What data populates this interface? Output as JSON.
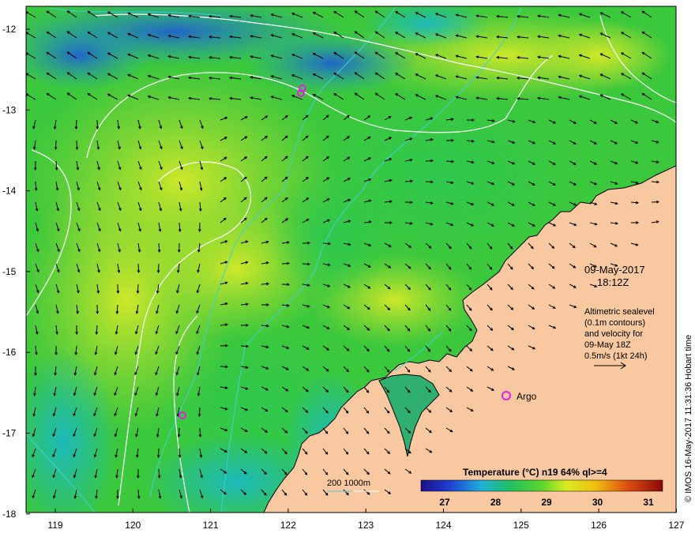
{
  "map": {
    "date": "09-May-2017",
    "time": "18:12Z",
    "altimetry_lines": [
      "Altimetric sealevel",
      "(0.1m contours)",
      "and velocity for",
      "09-May 18Z",
      "0.5m/s (1kt 24h)"
    ],
    "argo_label": "Argo",
    "depth_legend": "200  1000m",
    "colorbar_title": "Temperature (°C) n19 64% ql>=4",
    "colorbar_ticks": [
      "27",
      "28",
      "29",
      "30",
      "31"
    ],
    "lat_ticks": [
      "-12",
      "-13",
      "-14",
      "-15",
      "-16",
      "-17",
      "-18"
    ],
    "lon_ticks": [
      "119",
      "120",
      "121",
      "122",
      "123",
      "124",
      "125",
      "126",
      "127"
    ],
    "credit": "© IMOS 16-May-2017 11:31:36 Hobart time",
    "colors": {
      "land": "#f8c8a0",
      "sst_low": "#1e1eb4",
      "sst_mid": "#2ecc40",
      "sst_high": "#e8f02a",
      "contour": "#ffffff",
      "isobath": "#40d0d0",
      "argo_marker": "#e020e0"
    }
  }
}
